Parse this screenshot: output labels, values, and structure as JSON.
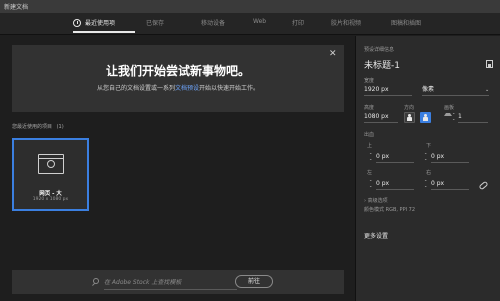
{
  "window": {
    "title": "新建文档"
  },
  "tabs": [
    "最近使用项",
    "已保存",
    "移动设备",
    "Web",
    "打印",
    "胶片和视频",
    "图稿和插图"
  ],
  "welcome": {
    "title": "让我们开始尝试新事物吧。",
    "subtitle_before": "从您自己的文档设置或一系列",
    "subtitle_link": "文档预设",
    "subtitle_after": "开始以快速开始工作。"
  },
  "recent": {
    "label": "您最近使用的项目",
    "count": "(1)",
    "items": [
      {
        "name": "网页 - 大",
        "size": "1920 x 1080 px"
      }
    ]
  },
  "search": {
    "placeholder": "在 Adobe Stock 上查找模板",
    "go_label": "前往"
  },
  "details": {
    "section_label": "预设详细信息",
    "doc_name": "未标题-1",
    "width_label": "宽度",
    "width_value": "1920 px",
    "unit_value": "像素",
    "height_label": "高度",
    "height_value": "1080 px",
    "orientation_label": "方向",
    "artboards_label": "画板",
    "artboards_value": "1",
    "bleed_label": "出血",
    "top_label": "上",
    "bottom_label": "下",
    "left_label": "左",
    "right_label": "右",
    "top_value": "0 px",
    "bottom_value": "0 px",
    "left_value": "0 px",
    "right_value": "0 px",
    "advanced_label": "高级选项",
    "color_mode_text": "颜色模式 RGB, PPI 72",
    "more_settings_label": "更多设置"
  },
  "colors": {
    "accent": "#3b7fe0",
    "panel": "#2b2b2b",
    "background": "#1e1e1e"
  }
}
